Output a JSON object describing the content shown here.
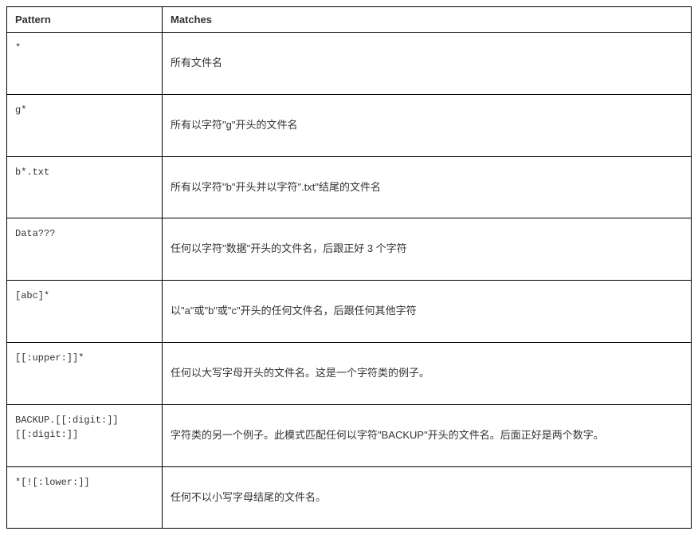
{
  "chart_data": {
    "type": "table",
    "headers": [
      "Pattern",
      "Matches"
    ],
    "rows": [
      {
        "pattern": "*",
        "matches": "所有文件名"
      },
      {
        "pattern": "g*",
        "matches": "所有以字符\"g\"开头的文件名"
      },
      {
        "pattern": "b*.txt",
        "matches": "所有以字符\"b\"开头并以字符\".txt\"结尾的文件名"
      },
      {
        "pattern": "Data???",
        "matches": "任何以字符\"数据\"开头的文件名，后跟正好 3 个字符"
      },
      {
        "pattern": "[abc]*",
        "matches": "以\"a\"或\"b\"或\"c\"开头的任何文件名，后跟任何其他字符"
      },
      {
        "pattern": "[[:upper:]]*",
        "matches": "任何以大写字母开头的文件名。这是一个字符类的例子。"
      },
      {
        "pattern": "BACKUP.[[:digit:]][[:digit:]]",
        "matches": "字符类的另一个例子。此模式匹配任何以字符\"BACKUP\"开头的文件名。后面正好是两个数字。"
      },
      {
        "pattern": "*[![:lower:]]",
        "matches": "任何不以小写字母结尾的文件名。"
      }
    ]
  }
}
